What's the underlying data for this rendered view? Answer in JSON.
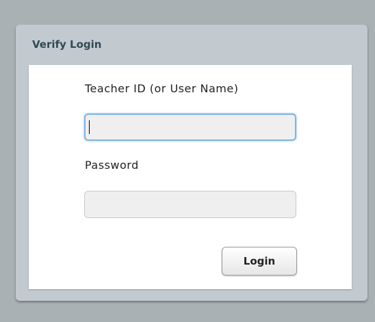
{
  "dialog": {
    "title": "Verify Login"
  },
  "form": {
    "teacher_id_label": "Teacher ID (or User Name)",
    "teacher_id_value": "",
    "password_label": "Password",
    "password_value": "",
    "login_label": "Login"
  },
  "colors": {
    "page_background": "#a9b1b5",
    "panel_background": "#c3cacf",
    "title_color": "#2f4a55",
    "focus_ring": "#7fb4e2"
  }
}
